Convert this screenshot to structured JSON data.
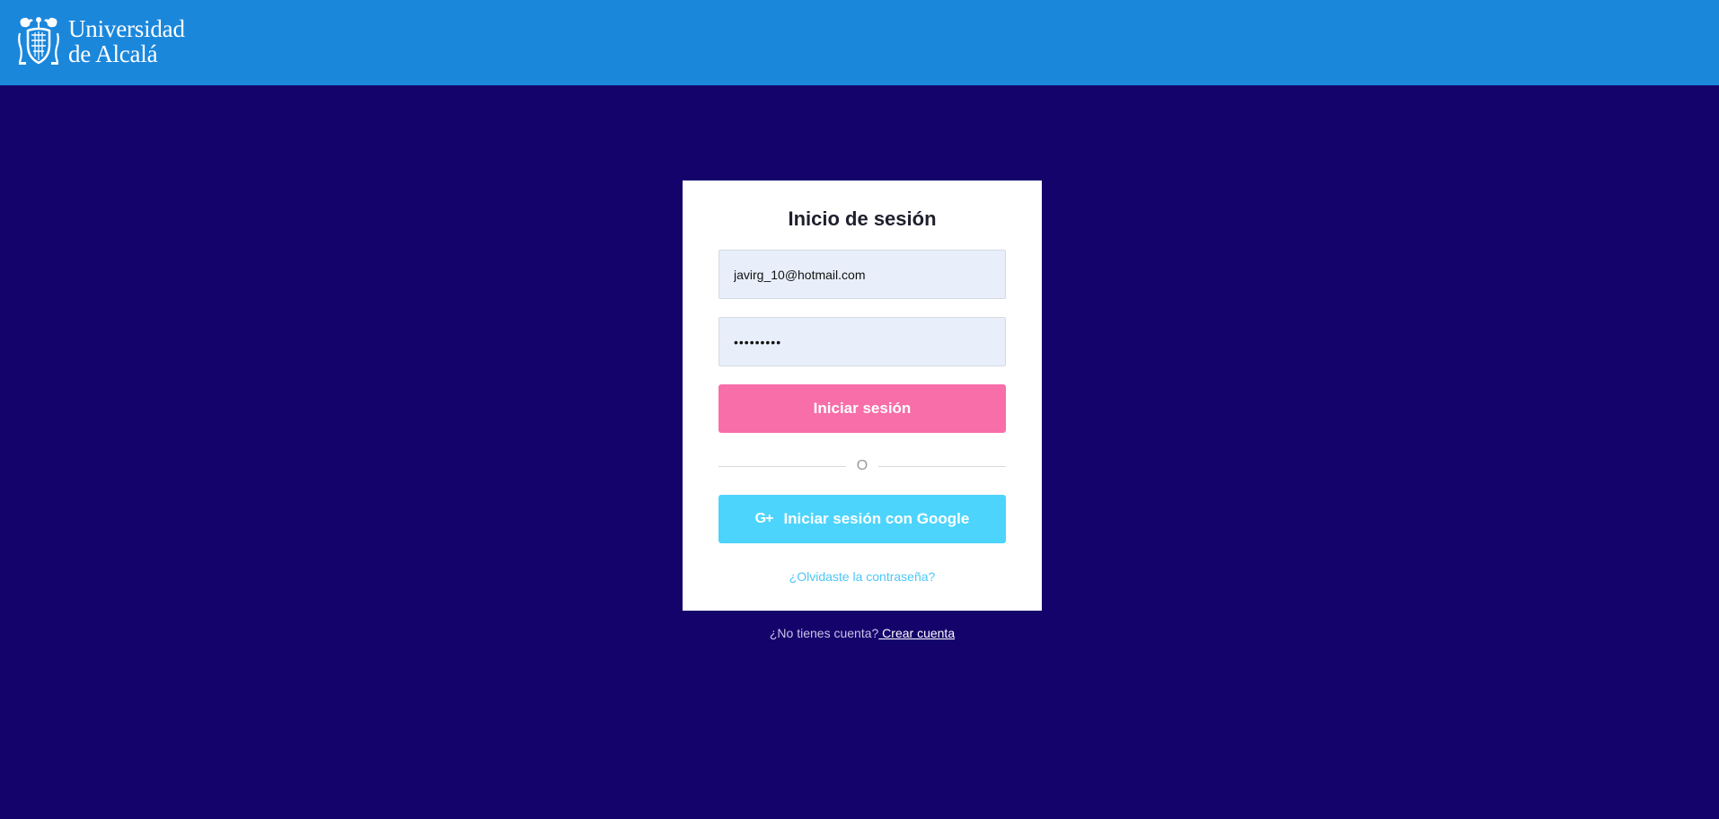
{
  "header": {
    "logo_line1": "Universidad",
    "logo_line2": "de Alcalá",
    "background_color": "#1b87db"
  },
  "page": {
    "background_color": "#14036b"
  },
  "login_card": {
    "title": "Inicio de sesión",
    "email_value": "javirg_10@hotmail.com",
    "password_value": "123456789",
    "login_button_label": "Iniciar sesión",
    "login_button_color": "#f76ea8",
    "divider_text": "O",
    "google_icon": "G+",
    "google_button_label": "Iniciar sesión con Google",
    "google_button_color": "#4dd4fd",
    "forgot_password_link": "¿Olvidaste la contraseña?"
  },
  "signup": {
    "prompt": "¿No tienes cuenta?",
    "link_label": " Crear cuenta"
  }
}
